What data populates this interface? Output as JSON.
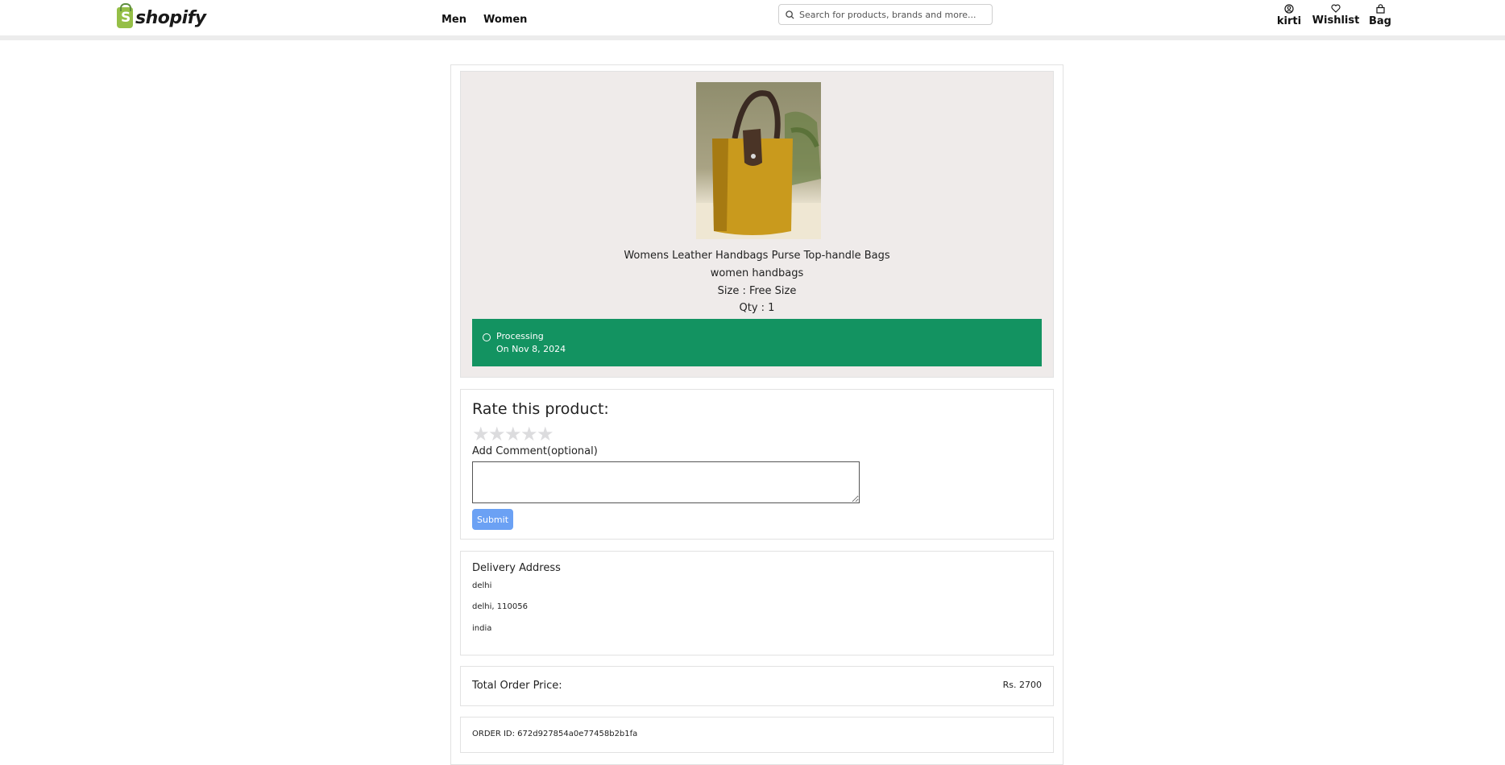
{
  "header": {
    "logo_text": "shopify",
    "logo_mark": "S",
    "nav": [
      {
        "label": "Men"
      },
      {
        "label": "Women"
      }
    ],
    "search": {
      "placeholder": "Search for products, brands and more..."
    },
    "actions": {
      "profile_label": "kirti",
      "wishlist_label": "Wishlist",
      "bag_label": "Bag"
    }
  },
  "product": {
    "name": "Womens Leather Handbags Purse Top-handle Bags",
    "category": "women handbags",
    "size": "Size : Free Size",
    "qty": "Qty : 1",
    "status": "Processing",
    "status_date": "On Nov 8, 2024",
    "status_color": "#139361"
  },
  "rating": {
    "title": "Rate this product:",
    "stars_total": 5,
    "stars_selected": 0,
    "comment_label": "Add Comment(optional)",
    "comment_value": "",
    "submit_label": "Submit"
  },
  "address": {
    "title": "Delivery Address",
    "line1": "delhi",
    "line2": "delhi, 110056",
    "line3": "india"
  },
  "total": {
    "label": "Total Order Price:",
    "value": "Rs. 2700"
  },
  "order": {
    "id_text": "ORDER ID: 672d927854a0e77458b2b1fa"
  }
}
